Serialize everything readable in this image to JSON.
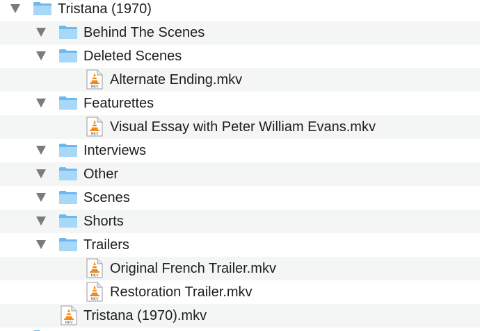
{
  "tree": {
    "root": {
      "label": "Tristana (1970)",
      "expanded": true,
      "icon": "folder-icon"
    },
    "children": [
      {
        "label": "Behind The Scenes",
        "type": "folder",
        "expanded": true
      },
      {
        "label": "Deleted Scenes",
        "type": "folder",
        "expanded": true
      },
      {
        "label": "Alternate Ending.mkv",
        "type": "file"
      },
      {
        "label": "Featurettes",
        "type": "folder",
        "expanded": true
      },
      {
        "label": "Visual Essay with Peter William Evans.mkv",
        "type": "file"
      },
      {
        "label": "Interviews",
        "type": "folder",
        "expanded": true
      },
      {
        "label": "Other",
        "type": "folder",
        "expanded": true
      },
      {
        "label": "Scenes",
        "type": "folder",
        "expanded": true
      },
      {
        "label": "Shorts",
        "type": "folder",
        "expanded": true
      },
      {
        "label": "Trailers",
        "type": "folder",
        "expanded": true
      },
      {
        "label": "Original French Trailer.mkv",
        "type": "file"
      },
      {
        "label": "Restoration Trailer.mkv",
        "type": "file"
      },
      {
        "label": "Tristana (1970).mkv",
        "type": "file"
      }
    ],
    "file_badge": "MKV",
    "colors": {
      "folder_light": "#a8d8f8",
      "folder_dark": "#6ab8ee",
      "row_alt": "#f4f5f5",
      "text": "#1d1d1d",
      "disclosure": "#7b7b7b",
      "vlc_orange": "#f28a1a"
    }
  }
}
